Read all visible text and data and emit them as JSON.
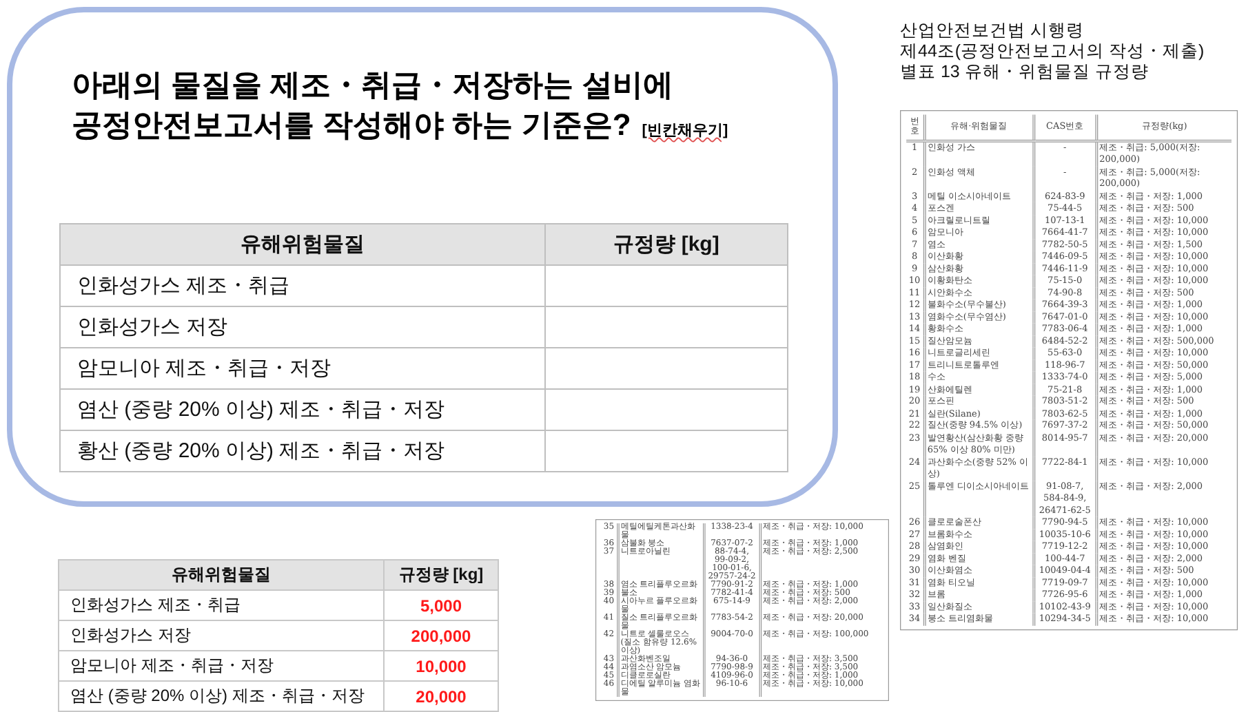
{
  "question": {
    "title_lines": [
      "아래의 물질을 제조・취급・저장하는 설비에",
      "공정안전보고서를 작성해야 하는 기준은?"
    ],
    "hint": "[빈칸채우기]"
  },
  "blank_table": {
    "columns": [
      "유해위험물질",
      "규정량 [kg]"
    ],
    "rows": [
      "인화성가스 제조・취급",
      "인화성가스 저장",
      "암모니아 제조・취급・저장",
      "염산 (중량 20% 이상) 제조・취급・저장",
      "황산 (중량 20% 이상) 제조・취급・저장"
    ]
  },
  "answer_table": {
    "columns": [
      "유해위험물질",
      "규정량 [kg]"
    ],
    "rows": [
      {
        "substance": "인화성가스 제조・취급",
        "amount": "5,000"
      },
      {
        "substance": "인화성가스 저장",
        "amount": "200,000"
      },
      {
        "substance": "암모니아 제조・취급・저장",
        "amount": "10,000"
      },
      {
        "substance": "염산 (중량 20% 이상) 제조・취급・저장",
        "amount": "20,000"
      }
    ]
  },
  "reference": {
    "lines": [
      "산업안전보건법 시행령",
      "제44조(공정안전보고서의 작성・제출)",
      "별표 13 유해・위험물질 규정량"
    ],
    "columns": [
      "번호",
      "유해·위험물질",
      "CAS번호",
      "규정량(kg)"
    ],
    "rows": [
      {
        "no": "1",
        "name": "인화성 가스",
        "cas": "-",
        "amount": "제조・취급: 5,000(저장: 200,000)"
      },
      {
        "no": "2",
        "name": "인화성 액체",
        "cas": "-",
        "amount": "제조・취급: 5,000(저장: 200,000)"
      },
      {
        "no": "3",
        "name": "메틸 이소시아네이트",
        "cas": "624-83-9",
        "amount": "제조・취급・저장: 1,000"
      },
      {
        "no": "4",
        "name": "포스겐",
        "cas": "75-44-5",
        "amount": "제조・취급・저장: 500"
      },
      {
        "no": "5",
        "name": "아크릴로니트릴",
        "cas": "107-13-1",
        "amount": "제조・취급・저장: 10,000"
      },
      {
        "no": "6",
        "name": "암모니아",
        "cas": "7664-41-7",
        "amount": "제조・취급・저장: 10,000"
      },
      {
        "no": "7",
        "name": "염소",
        "cas": "7782-50-5",
        "amount": "제조・취급・저장: 1,500"
      },
      {
        "no": "8",
        "name": "이산화황",
        "cas": "7446-09-5",
        "amount": "제조・취급・저장: 10,000"
      },
      {
        "no": "9",
        "name": "삼산화황",
        "cas": "7446-11-9",
        "amount": "제조・취급・저장: 10,000"
      },
      {
        "no": "10",
        "name": "이황화탄소",
        "cas": "75-15-0",
        "amount": "제조・취급・저장: 10,000"
      },
      {
        "no": "11",
        "name": "시안화수소",
        "cas": "74-90-8",
        "amount": "제조・취급・저장: 500"
      },
      {
        "no": "12",
        "name": "불화수소(무수불산)",
        "cas": "7664-39-3",
        "amount": "제조・취급・저장: 1,000"
      },
      {
        "no": "13",
        "name": "염화수소(무수염산)",
        "cas": "7647-01-0",
        "amount": "제조・취급・저장: 10,000"
      },
      {
        "no": "14",
        "name": "황화수소",
        "cas": "7783-06-4",
        "amount": "제조・취급・저장: 1,000"
      },
      {
        "no": "15",
        "name": "질산암모늄",
        "cas": "6484-52-2",
        "amount": "제조・취급・저장: 500,000"
      },
      {
        "no": "16",
        "name": "니트로글리세린",
        "cas": "55-63-0",
        "amount": "제조・취급・저장: 10,000"
      },
      {
        "no": "17",
        "name": "트리니트로톨루엔",
        "cas": "118-96-7",
        "amount": "제조・취급・저장: 50,000"
      },
      {
        "no": "18",
        "name": "수소",
        "cas": "1333-74-0",
        "amount": "제조・취급・저장: 5,000"
      },
      {
        "no": "19",
        "name": "산화에틸렌",
        "cas": "75-21-8",
        "amount": "제조・취급・저장: 1,000"
      },
      {
        "no": "20",
        "name": "포스핀",
        "cas": "7803-51-2",
        "amount": "제조・취급・저장: 500"
      },
      {
        "no": "21",
        "name": "실란(Silane)",
        "cas": "7803-62-5",
        "amount": "제조・취급・저장: 1,000"
      },
      {
        "no": "22",
        "name": "질산(중량 94.5% 이상)",
        "cas": "7697-37-2",
        "amount": "제조・취급・저장: 50,000"
      },
      {
        "no": "23",
        "name": "발연황산(삼산화황 중량 65% 이상 80% 미만)",
        "cas": "8014-95-7",
        "amount": "제조・취급・저장: 20,000"
      },
      {
        "no": "24",
        "name": "과산화수소(중량 52% 이상)",
        "cas": "7722-84-1",
        "amount": "제조・취급・저장: 10,000"
      },
      {
        "no": "25",
        "name": "톨루엔 디이소시아네이트",
        "cas": "91-08-7, 584-84-9, 26471-62-5",
        "amount": "제조・취급・저장: 2,000"
      },
      {
        "no": "26",
        "name": "클로로술폰산",
        "cas": "7790-94-5",
        "amount": "제조・취급・저장: 10,000"
      },
      {
        "no": "27",
        "name": "브롬화수소",
        "cas": "10035-10-6",
        "amount": "제조・취급・저장: 10,000"
      },
      {
        "no": "28",
        "name": "삼염화인",
        "cas": "7719-12-2",
        "amount": "제조・취급・저장: 10,000"
      },
      {
        "no": "29",
        "name": "염화 벤질",
        "cas": "100-44-7",
        "amount": "제조・취급・저장: 2,000"
      },
      {
        "no": "30",
        "name": "이산화염소",
        "cas": "10049-04-4",
        "amount": "제조・취급・저장: 500"
      },
      {
        "no": "31",
        "name": "염화 티오닐",
        "cas": "7719-09-7",
        "amount": "제조・취급・저장: 10,000"
      },
      {
        "no": "32",
        "name": "브롬",
        "cas": "7726-95-6",
        "amount": "제조・취급・저장: 1,000"
      },
      {
        "no": "33",
        "name": "일산화질소",
        "cas": "10102-43-9",
        "amount": "제조・취급・저장: 10,000"
      },
      {
        "no": "34",
        "name": "붕소 트리염화물",
        "cas": "10294-34-5",
        "amount": "제조・취급・저장: 10,000"
      }
    ]
  },
  "continuation": {
    "rows": [
      {
        "no": "35",
        "name": "메틸에틸케톤과산화물",
        "cas": "1338-23-4",
        "amount": "제조・취급・저장: 10,000"
      },
      {
        "no": "36",
        "name": "삼불화 붕소",
        "cas": "7637-07-2",
        "amount": "제조・취급・저장: 1,000"
      },
      {
        "no": "37",
        "name": "니트로아닐린",
        "cas": "88-74-4, 99-09-2, 100-01-6, 29757-24-2",
        "amount": "제조・취급・저장: 2,500"
      },
      {
        "no": "38",
        "name": "염소 트리플루오르화",
        "cas": "7790-91-2",
        "amount": "제조・취급・저장: 1,000"
      },
      {
        "no": "39",
        "name": "불소",
        "cas": "7782-41-4",
        "amount": "제조・취급・저장: 500"
      },
      {
        "no": "40",
        "name": "시아누르 플루오르화물",
        "cas": "675-14-9",
        "amount": "제조・취급・저장: 2,000"
      },
      {
        "no": "41",
        "name": "질소 트리플루오르화물",
        "cas": "7783-54-2",
        "amount": "제조・취급・저장: 20,000"
      },
      {
        "no": "42",
        "name": "니트로 셀룰로오스(질소 함유량 12.6% 이상)",
        "cas": "9004-70-0",
        "amount": "제조・취급・저장: 100,000"
      },
      {
        "no": "43",
        "name": "과산화벤조일",
        "cas": "94-36-0",
        "amount": "제조・취급・저장: 3,500"
      },
      {
        "no": "44",
        "name": "과염소산 암모늄",
        "cas": "7790-98-9",
        "amount": "제조・취급・저장: 3,500"
      },
      {
        "no": "45",
        "name": "디클로로실란",
        "cas": "4109-96-0",
        "amount": "제조・취급・저장: 1,000"
      },
      {
        "no": "46",
        "name": "디에틸 알루미늄 염화물",
        "cas": "96-10-6",
        "amount": "제조・취급・저장: 10,000"
      }
    ]
  }
}
